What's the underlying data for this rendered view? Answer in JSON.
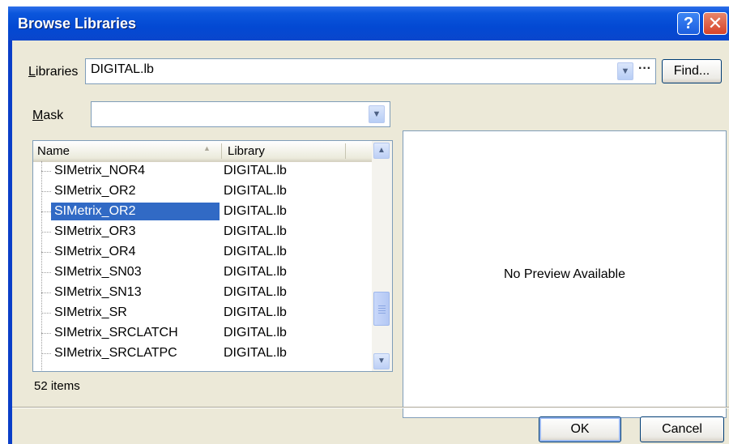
{
  "window": {
    "title": "Browse Libraries",
    "help_label": "?",
    "close_label": "✕"
  },
  "libraries": {
    "label_accel": "L",
    "label_rest": "ibraries",
    "value": "DIGITAL.lb",
    "ellipsis_label": "···",
    "find_label": "Find..."
  },
  "mask": {
    "label_accel": "M",
    "label_rest": "ask",
    "value": ""
  },
  "list": {
    "columns": [
      "Name",
      "Library"
    ],
    "rows": [
      {
        "name": "SIMetrix_NOR4",
        "library": "DIGITAL.lb"
      },
      {
        "name": "SIMetrix_OR2",
        "library": "DIGITAL.lb"
      },
      {
        "name": "SIMetrix_OR2",
        "library": "DIGITAL.lb"
      },
      {
        "name": "SIMetrix_OR3",
        "library": "DIGITAL.lb"
      },
      {
        "name": "SIMetrix_OR4",
        "library": "DIGITAL.lb"
      },
      {
        "name": "SIMetrix_SN03",
        "library": "DIGITAL.lb"
      },
      {
        "name": "SIMetrix_SN13",
        "library": "DIGITAL.lb"
      },
      {
        "name": "SIMetrix_SR",
        "library": "DIGITAL.lb"
      },
      {
        "name": "SIMetrix_SRCLATCH",
        "library": "DIGITAL.lb"
      },
      {
        "name": "SIMetrix_SRCLATPC",
        "library": "DIGITAL.lb"
      }
    ],
    "selected_index": 2,
    "item_count": "52 items"
  },
  "preview": {
    "text": "No Preview Available"
  },
  "buttons": {
    "ok": "OK",
    "cancel": "Cancel"
  },
  "icons": {
    "help": "help-icon",
    "close": "close-icon",
    "dropdown": "chevron-down-icon",
    "scroll_up": "scroll-up-icon",
    "scroll_down": "scroll-down-icon"
  }
}
